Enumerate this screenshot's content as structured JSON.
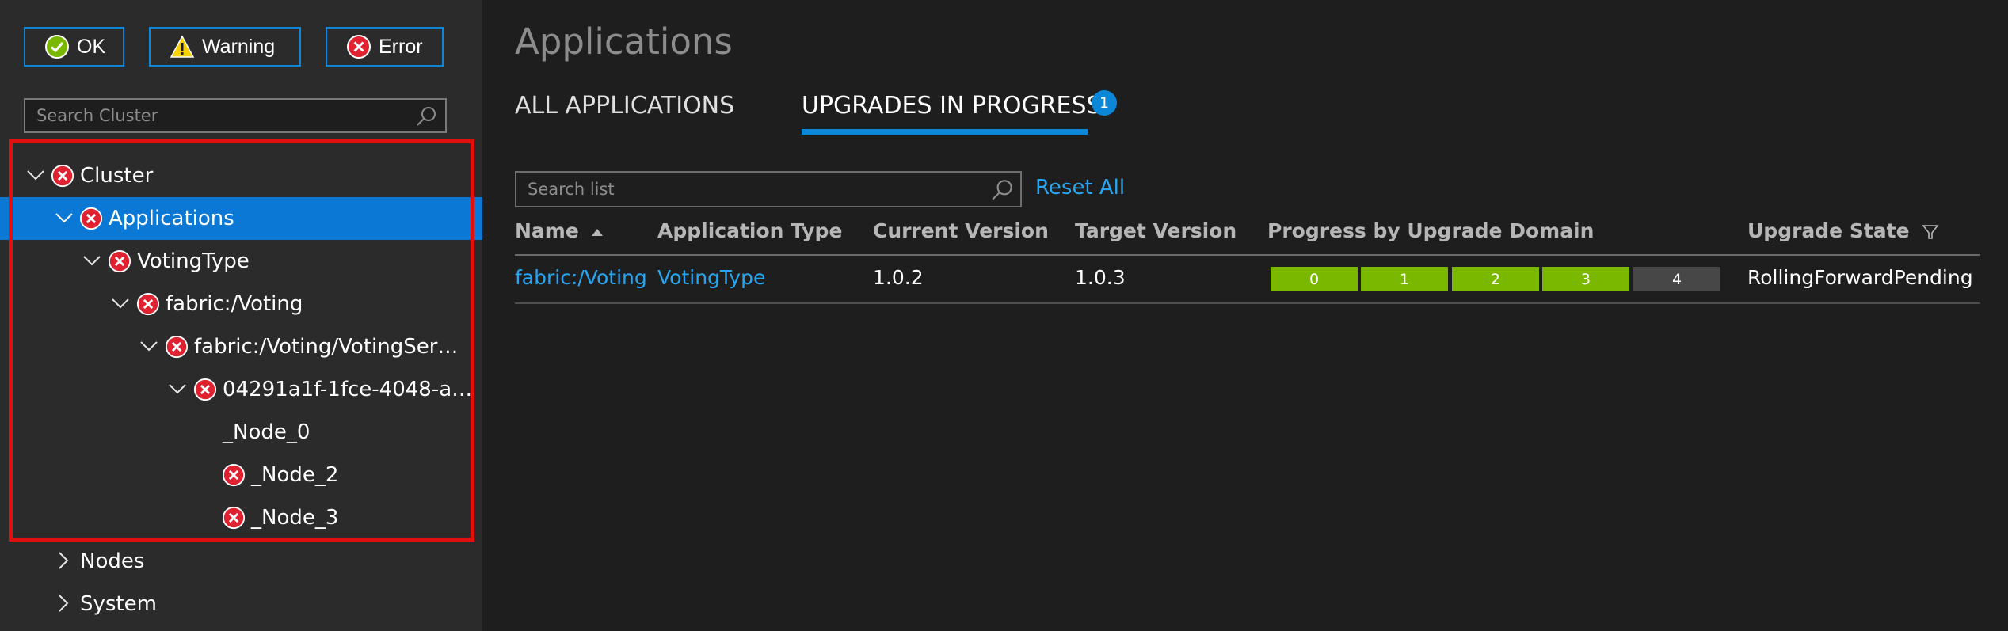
{
  "filters": {
    "ok": "OK",
    "warning": "Warning",
    "error": "Error"
  },
  "cluster_search": {
    "placeholder": "Search Cluster"
  },
  "tree": {
    "cluster": "Cluster",
    "applications": "Applications",
    "voting_type": "VotingType",
    "fabric_voting": "fabric:/Voting",
    "voting_service": "fabric:/Voting/VotingSer…",
    "partition": "04291a1f-1fce-4048-a…",
    "node0": "_Node_0",
    "node2": "_Node_2",
    "node3": "_Node_3",
    "nodes": "Nodes",
    "system": "System"
  },
  "page": {
    "title": "Applications",
    "tabs": [
      "ALL APPLICATIONS",
      "UPGRADES IN PROGRESS"
    ],
    "badge": "1"
  },
  "list": {
    "search_placeholder": "Search list",
    "reset_label": "Reset All",
    "columns": [
      "Name",
      "Application Type",
      "Current Version",
      "Target Version",
      "Progress by Upgrade Domain",
      "Upgrade State"
    ],
    "sort_column": "Name",
    "sort_direction": "ascending",
    "rows": [
      {
        "name": "fabric:/Voting",
        "type": "VotingType",
        "current_version": "1.0.2",
        "target_version": "1.0.3",
        "upgrade_domains": [
          {
            "label": "0",
            "status": "completed"
          },
          {
            "label": "1",
            "status": "completed"
          },
          {
            "label": "2",
            "status": "completed"
          },
          {
            "label": "3",
            "status": "completed"
          },
          {
            "label": "4",
            "status": "pending"
          }
        ],
        "state": "RollingForwardPending"
      }
    ]
  },
  "colors": {
    "accent": "#0c86d6",
    "selected": "#0a78d4",
    "link": "#27a6f2",
    "error": "#e0212f",
    "ok": "#7ab800",
    "highlight": "#e01010",
    "domain_completed": "#7ab800",
    "domain_pending": "#474747"
  },
  "icons": [
    "ok-icon",
    "warning-icon",
    "error-icon",
    "search-icon",
    "chevron-down-icon",
    "chevron-right-icon",
    "sort-asc-icon",
    "filter-icon"
  ]
}
